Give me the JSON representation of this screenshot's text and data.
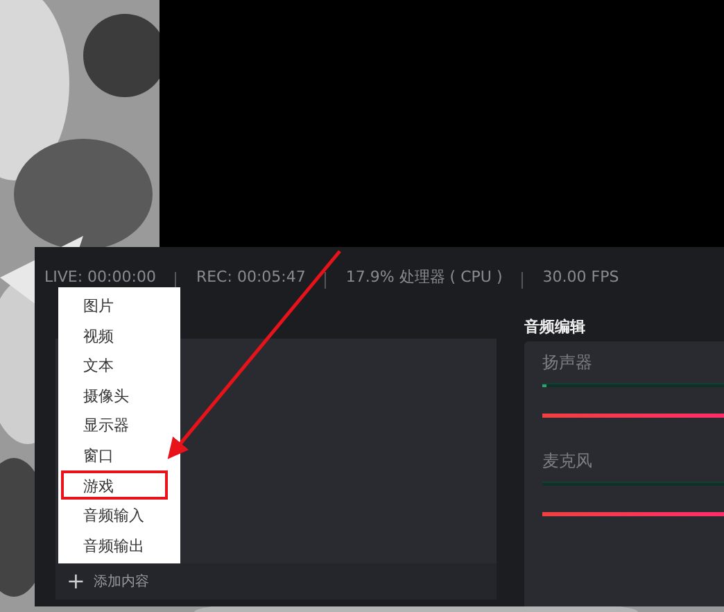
{
  "status_bar": [
    "LIVE: 00:00:00",
    "REC: 00:05:47",
    "17.9% 处理器 ( CPU )",
    "30.00 FPS"
  ],
  "context_menu": [
    {
      "label": "图片",
      "marked": false
    },
    {
      "label": "视频",
      "marked": false
    },
    {
      "label": "文本",
      "marked": false
    },
    {
      "label": "摄像头",
      "marked": false
    },
    {
      "label": "显示器",
      "marked": false
    },
    {
      "label": "窗口",
      "marked": false
    },
    {
      "label": "游戏",
      "marked": true
    },
    {
      "label": "音频输入",
      "marked": false
    },
    {
      "label": "音频输出",
      "marked": false
    }
  ],
  "sources": {
    "add_button": {
      "icon": "+",
      "label": "添加内容"
    }
  },
  "audio_mixer": {
    "title": "音频编辑",
    "channels": [
      {
        "name": "扬声器",
        "meter": {
          "level": 0.01
        },
        "volume": {
          "level": 1
        }
      },
      {
        "name": "麦克风",
        "meter": {
          "level": 0
        },
        "volume": {
          "level": 1
        }
      }
    ]
  }
}
